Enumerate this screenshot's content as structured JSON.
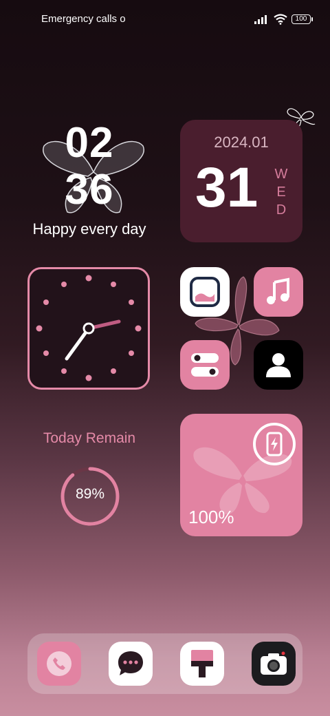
{
  "status_bar": {
    "carrier_text": "Emergency calls o",
    "battery_level": "100"
  },
  "clock_widget": {
    "hours": "02",
    "minutes": "36",
    "caption": "Happy every day"
  },
  "date_widget": {
    "year_month": "2024.01",
    "day": "31",
    "weekday_letters": [
      "W",
      "E",
      "D"
    ]
  },
  "remain_widget": {
    "title": "Today Remain",
    "percent_label": "89%",
    "percent_value": 0.89
  },
  "battery_widget": {
    "percent_label": "100%"
  },
  "app_grid": [
    {
      "icon": "gallery-icon"
    },
    {
      "icon": "music-icon"
    },
    {
      "icon": "settings-toggle-icon"
    },
    {
      "icon": "contacts-icon"
    }
  ],
  "dock": [
    {
      "icon": "phone-icon"
    },
    {
      "icon": "messages-icon"
    },
    {
      "icon": "theme-brush-icon"
    },
    {
      "icon": "camera-icon"
    }
  ],
  "colors": {
    "accent_pink": "#e283a2",
    "date_card": "#4a1e2e",
    "clock_hand": "#c05c82"
  }
}
